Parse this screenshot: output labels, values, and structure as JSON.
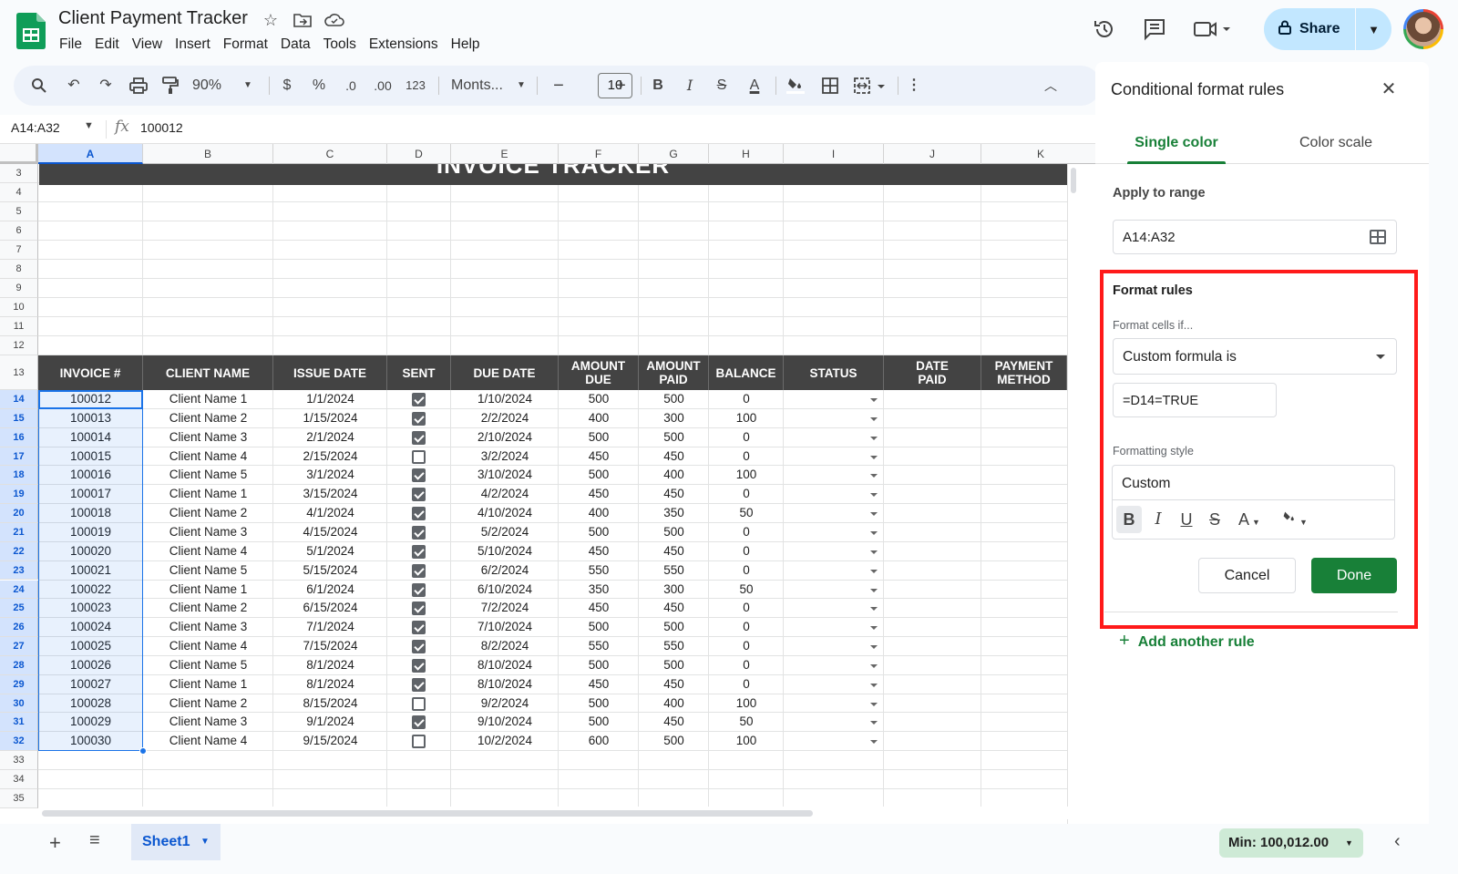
{
  "app": {
    "doc_title": "Client Payment Tracker",
    "menus": [
      "File",
      "Edit",
      "View",
      "Insert",
      "Format",
      "Data",
      "Tools",
      "Extensions",
      "Help"
    ],
    "share_label": "Share"
  },
  "toolbar": {
    "zoom": "90%",
    "currency": "$",
    "percent": "%",
    "dec_decrease": ".0",
    "dec_increase": ".00",
    "number_format": "123",
    "font": "Monts...",
    "font_size": "10",
    "bold": "B",
    "italic": "I",
    "strike": "S",
    "text_color": "A"
  },
  "formula_bar": {
    "name_box": "A14:A32",
    "fx": "fx",
    "value": "100012"
  },
  "grid": {
    "columns": [
      "A",
      "B",
      "C",
      "D",
      "E",
      "F",
      "G",
      "H",
      "I",
      "J",
      "K"
    ],
    "selected_column": "A",
    "blank_rows": [
      "3",
      "4",
      "5",
      "6",
      "7",
      "8",
      "9",
      "10",
      "11",
      "12"
    ],
    "header_row_num": "13",
    "banner": "INVOICE TRACKER",
    "headers": [
      "INVOICE #",
      "CLIENT NAME",
      "ISSUE DATE",
      "SENT",
      "DUE DATE",
      "AMOUNT DUE",
      "AMOUNT PAID",
      "BALANCE",
      "STATUS",
      "DATE PAID",
      "PAYMENT METHOD"
    ],
    "rows": [
      {
        "row": "14",
        "invoice": "100012",
        "client": "Client Name 1",
        "issue": "1/1/2024",
        "sent": true,
        "due": "1/10/2024",
        "amount_due": "500",
        "amount_paid": "500",
        "balance": "0"
      },
      {
        "row": "15",
        "invoice": "100013",
        "client": "Client Name 2",
        "issue": "1/15/2024",
        "sent": true,
        "due": "2/2/2024",
        "amount_due": "400",
        "amount_paid": "300",
        "balance": "100"
      },
      {
        "row": "16",
        "invoice": "100014",
        "client": "Client Name 3",
        "issue": "2/1/2024",
        "sent": true,
        "due": "2/10/2024",
        "amount_due": "500",
        "amount_paid": "500",
        "balance": "0"
      },
      {
        "row": "17",
        "invoice": "100015",
        "client": "Client Name 4",
        "issue": "2/15/2024",
        "sent": false,
        "due": "3/2/2024",
        "amount_due": "450",
        "amount_paid": "450",
        "balance": "0"
      },
      {
        "row": "18",
        "invoice": "100016",
        "client": "Client Name 5",
        "issue": "3/1/2024",
        "sent": true,
        "due": "3/10/2024",
        "amount_due": "500",
        "amount_paid": "400",
        "balance": "100"
      },
      {
        "row": "19",
        "invoice": "100017",
        "client": "Client Name 1",
        "issue": "3/15/2024",
        "sent": true,
        "due": "4/2/2024",
        "amount_due": "450",
        "amount_paid": "450",
        "balance": "0"
      },
      {
        "row": "20",
        "invoice": "100018",
        "client": "Client Name 2",
        "issue": "4/1/2024",
        "sent": true,
        "due": "4/10/2024",
        "amount_due": "400",
        "amount_paid": "350",
        "balance": "50"
      },
      {
        "row": "21",
        "invoice": "100019",
        "client": "Client Name 3",
        "issue": "4/15/2024",
        "sent": true,
        "due": "5/2/2024",
        "amount_due": "500",
        "amount_paid": "500",
        "balance": "0"
      },
      {
        "row": "22",
        "invoice": "100020",
        "client": "Client Name 4",
        "issue": "5/1/2024",
        "sent": true,
        "due": "5/10/2024",
        "amount_due": "450",
        "amount_paid": "450",
        "balance": "0"
      },
      {
        "row": "23",
        "invoice": "100021",
        "client": "Client Name 5",
        "issue": "5/15/2024",
        "sent": true,
        "due": "6/2/2024",
        "amount_due": "550",
        "amount_paid": "550",
        "balance": "0"
      },
      {
        "row": "24",
        "invoice": "100022",
        "client": "Client Name 1",
        "issue": "6/1/2024",
        "sent": true,
        "due": "6/10/2024",
        "amount_due": "350",
        "amount_paid": "300",
        "balance": "50"
      },
      {
        "row": "25",
        "invoice": "100023",
        "client": "Client Name 2",
        "issue": "6/15/2024",
        "sent": true,
        "due": "7/2/2024",
        "amount_due": "450",
        "amount_paid": "450",
        "balance": "0"
      },
      {
        "row": "26",
        "invoice": "100024",
        "client": "Client Name 3",
        "issue": "7/1/2024",
        "sent": true,
        "due": "7/10/2024",
        "amount_due": "500",
        "amount_paid": "500",
        "balance": "0"
      },
      {
        "row": "27",
        "invoice": "100025",
        "client": "Client Name 4",
        "issue": "7/15/2024",
        "sent": true,
        "due": "8/2/2024",
        "amount_due": "550",
        "amount_paid": "550",
        "balance": "0"
      },
      {
        "row": "28",
        "invoice": "100026",
        "client": "Client Name 5",
        "issue": "8/1/2024",
        "sent": true,
        "due": "8/10/2024",
        "amount_due": "500",
        "amount_paid": "500",
        "balance": "0"
      },
      {
        "row": "29",
        "invoice": "100027",
        "client": "Client Name 1",
        "issue": "8/1/2024",
        "sent": true,
        "due": "8/10/2024",
        "amount_due": "450",
        "amount_paid": "450",
        "balance": "0"
      },
      {
        "row": "30",
        "invoice": "100028",
        "client": "Client Name 2",
        "issue": "8/15/2024",
        "sent": false,
        "due": "9/2/2024",
        "amount_due": "500",
        "amount_paid": "400",
        "balance": "100"
      },
      {
        "row": "31",
        "invoice": "100029",
        "client": "Client Name 3",
        "issue": "9/1/2024",
        "sent": true,
        "due": "9/10/2024",
        "amount_due": "500",
        "amount_paid": "450",
        "balance": "50"
      },
      {
        "row": "32",
        "invoice": "100030",
        "client": "Client Name 4",
        "issue": "9/15/2024",
        "sent": false,
        "due": "10/2/2024",
        "amount_due": "600",
        "amount_paid": "500",
        "balance": "100"
      }
    ],
    "trailing_rows": [
      "33",
      "34",
      "35"
    ]
  },
  "panel": {
    "title": "Conditional format rules",
    "tab_single": "Single color",
    "tab_scale": "Color scale",
    "apply_label": "Apply to range",
    "range": "A14:A32",
    "rules_title": "Format rules",
    "cells_if_label": "Format cells if...",
    "condition": "Custom formula is",
    "formula": "=D14=TRUE",
    "style_label": "Formatting style",
    "style_name": "Custom",
    "style_buttons": {
      "bold": "B",
      "italic": "I",
      "underline": "U",
      "strike": "S",
      "text_color": "A"
    },
    "cancel": "Cancel",
    "done": "Done",
    "add_rule": "Add another rule"
  },
  "bottom": {
    "sheet_name": "Sheet1",
    "status": "Min: 100,012.00"
  },
  "colors": {
    "accent_green": "#188038",
    "selection_blue": "#1a73e8",
    "header_dark": "#434343",
    "highlight_red": "#ff1a1a"
  }
}
